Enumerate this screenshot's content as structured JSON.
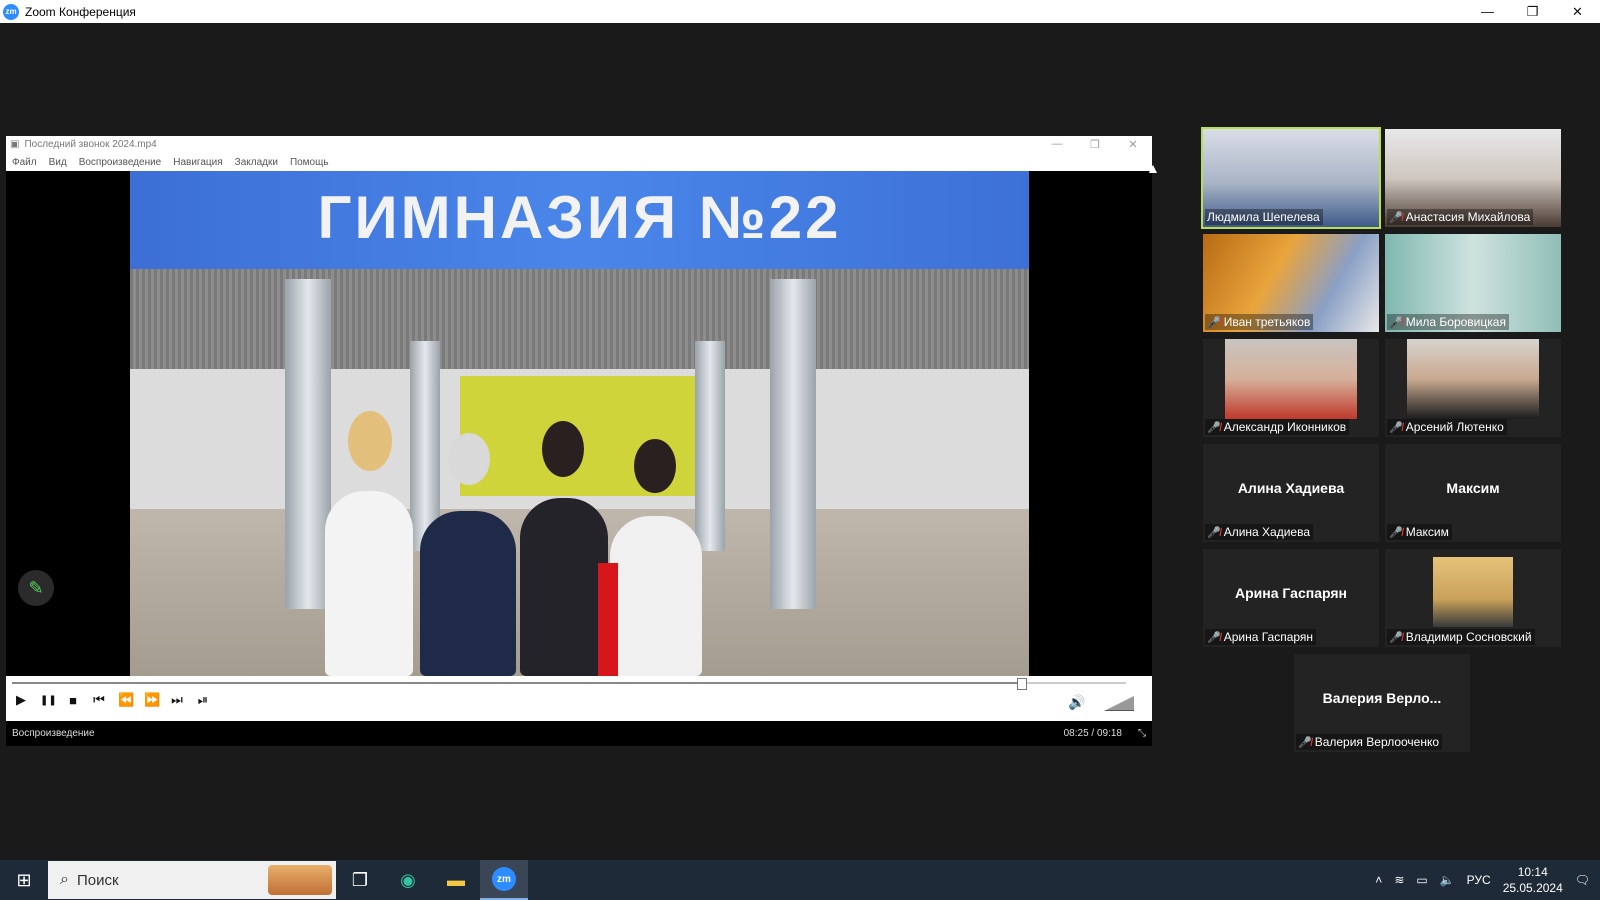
{
  "zoom_window": {
    "title": "Zoom Конференция",
    "minimize": "—",
    "maximize": "❐",
    "close": "✕"
  },
  "player": {
    "title": "Последний звонок 2024.mp4",
    "menu": [
      "Файл",
      "Вид",
      "Воспроизведение",
      "Навигация",
      "Закладки",
      "Помощь"
    ],
    "video_sign_text": "ГИМНАЗИЯ №22",
    "status_text": "Воспроизведение",
    "time_display": "08:25 / 09:18",
    "progress": 0.906,
    "buttons": {
      "play": "▶",
      "pause": "❚❚",
      "stop": "■",
      "prev": "⏮",
      "rewind": "⏪",
      "forward": "⏩",
      "next": "⏭",
      "frame_step": "⏯"
    }
  },
  "participants": [
    {
      "name": "Людмила Шепелева",
      "video": true,
      "muted": false,
      "active": true
    },
    {
      "name": "Анастасия Михайлова",
      "video": true,
      "muted": true
    },
    {
      "name": "Иван третьяков",
      "video": true,
      "muted": true
    },
    {
      "name": "Мила Боровицкая",
      "video": true,
      "muted": true
    },
    {
      "name": "Александр Иконников",
      "video": true,
      "muted": true
    },
    {
      "name": "Арсений Лютенко",
      "video": true,
      "muted": true
    },
    {
      "name": "Алина Хадиева",
      "display": "Алина Хадиева",
      "video": false,
      "muted": true
    },
    {
      "name": "Максим",
      "display": "Максим",
      "video": false,
      "muted": true
    },
    {
      "name": "Арина Гаспарян",
      "display": "Арина Гаспарян",
      "video": false,
      "muted": true
    },
    {
      "name": "Владимир Сосновский",
      "video": true,
      "muted": true
    },
    {
      "name": "Валерия Верлооченко",
      "display": "Валерия Верло...",
      "video": false,
      "muted": true
    }
  ],
  "taskbar": {
    "search_placeholder": "Поиск",
    "zoom_icon_text": "zm",
    "language": "РУС",
    "time": "10:14",
    "date": "25.05.2024"
  }
}
